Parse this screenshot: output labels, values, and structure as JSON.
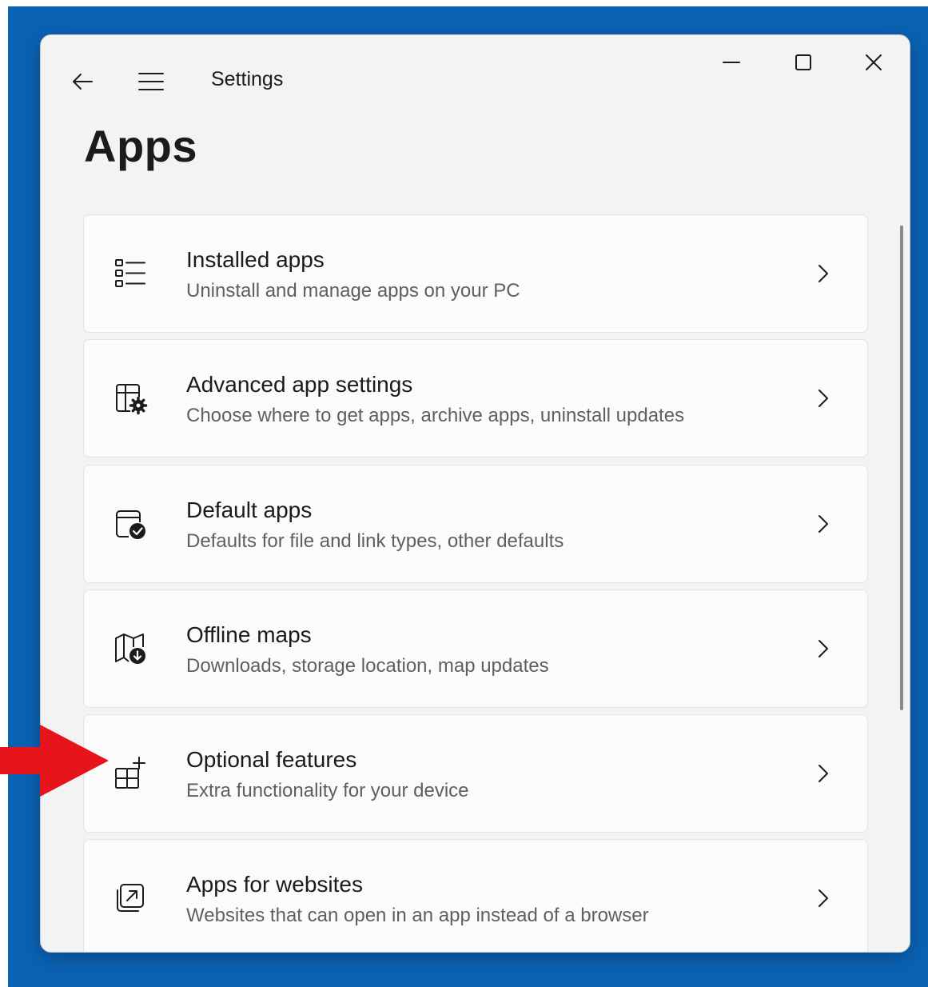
{
  "window": {
    "app_title": "Settings"
  },
  "page": {
    "title": "Apps"
  },
  "cards": [
    {
      "title": "Installed apps",
      "description": "Uninstall and manage apps on your PC",
      "icon": "installed-apps-icon"
    },
    {
      "title": "Advanced app settings",
      "description": "Choose where to get apps, archive apps, uninstall updates",
      "icon": "advanced-app-settings-icon"
    },
    {
      "title": "Default apps",
      "description": "Defaults for file and link types, other defaults",
      "icon": "default-apps-icon"
    },
    {
      "title": "Offline maps",
      "description": "Downloads, storage location, map updates",
      "icon": "offline-maps-icon"
    },
    {
      "title": "Optional features",
      "description": "Extra functionality for your device",
      "icon": "optional-features-icon"
    },
    {
      "title": "Apps for websites",
      "description": "Websites that can open in an app instead of a browser",
      "icon": "apps-for-websites-icon"
    }
  ],
  "colors": {
    "desktop": "#0a62b4",
    "window_bg": "#f3f3f3",
    "card_bg": "#fbfbfb",
    "annotation_arrow": "#e8141b"
  }
}
